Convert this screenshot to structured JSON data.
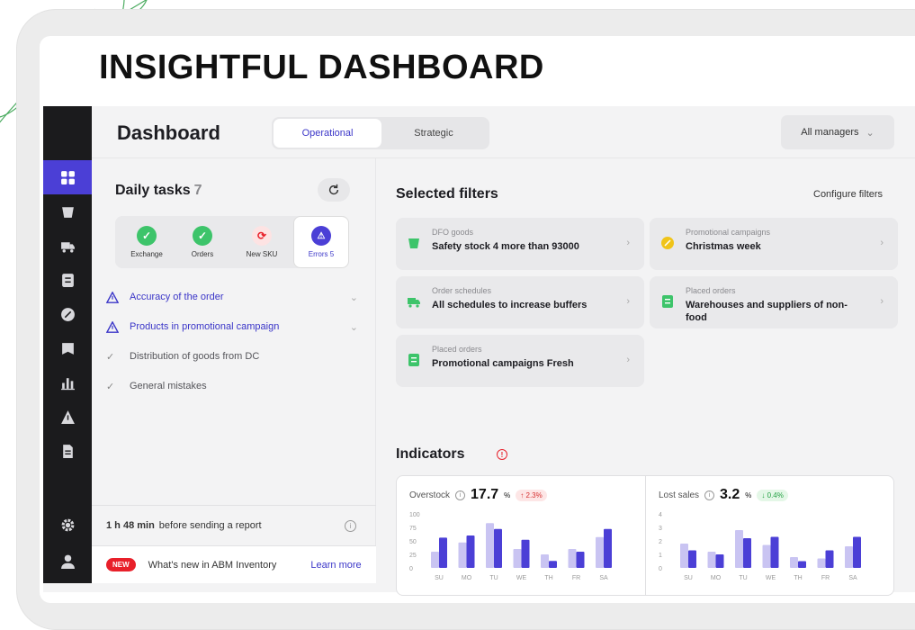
{
  "headline": "INSIGHTFUL DASHBOARD",
  "page_title": "Dashboard",
  "tabs": [
    {
      "label": "Operational",
      "active": true
    },
    {
      "label": "Strategic",
      "active": false
    }
  ],
  "managers_select": {
    "selected": "All managers"
  },
  "sidebar": {
    "items": [
      "grid-icon",
      "bucket-icon",
      "truck-icon",
      "list-icon",
      "percent-icon",
      "book-icon",
      "chart-icon",
      "alert-icon",
      "document-icon"
    ],
    "bottom": [
      "gear-icon",
      "user-icon"
    ]
  },
  "daily_tasks": {
    "title": "Daily tasks",
    "count": "7",
    "cards": [
      {
        "label": "Exchange",
        "status": "ok"
      },
      {
        "label": "Orders",
        "status": "ok"
      },
      {
        "label": "New SKU",
        "status": "sync"
      },
      {
        "label": "Errors 5",
        "status": "error",
        "selected": true
      }
    ],
    "items": [
      {
        "label": "Accuracy of the order",
        "type": "warning",
        "expandable": true
      },
      {
        "label": "Products in promotional campaign",
        "type": "warning",
        "expandable": true
      },
      {
        "label": "Distribution of goods from DC",
        "type": "done"
      },
      {
        "label": "General mistakes",
        "type": "done"
      }
    ]
  },
  "report": {
    "time": "1 h 48 min",
    "text": "before sending a report"
  },
  "news": {
    "badge": "NEW",
    "text": "What's new in ABM Inventory",
    "link": "Learn more"
  },
  "filters": {
    "title": "Selected filters",
    "configure": "Configure filters",
    "cards": [
      {
        "sub": "DFO goods",
        "main": "Safety stock 4 more than 93000",
        "icon": "bucket-icon",
        "color": "#3dc46a"
      },
      {
        "sub": "Promotional campaigns",
        "main": "Christmas week",
        "icon": "percent-icon",
        "color": "#f0c419"
      },
      {
        "sub": "Order schedules",
        "main": "All schedules to increase buffers",
        "icon": "truck-icon",
        "color": "#3dc46a"
      },
      {
        "sub": "Placed orders",
        "main": "Warehouses and suppliers of non-food",
        "icon": "list-icon",
        "color": "#3dc46a"
      },
      {
        "sub": "Placed orders",
        "main": "Promotional campaigns Fresh",
        "icon": "list-icon",
        "color": "#3dc46a"
      }
    ]
  },
  "indicators": {
    "title": "Indicators",
    "alert_icon": "alert-circle-icon"
  },
  "chart_data": [
    {
      "type": "bar",
      "title": "Overstock",
      "value": "17.7",
      "unit": "%",
      "delta": "↑ 2.3%",
      "delta_dir": "up",
      "categories": [
        "SU",
        "MO",
        "TU",
        "WE",
        "TH",
        "FR",
        "SA"
      ],
      "yticks": [
        "100",
        "75",
        "50",
        "25",
        "0"
      ],
      "ylim": [
        0,
        100
      ],
      "series": [
        {
          "values": [
            30,
            47,
            83,
            35,
            25,
            35,
            57
          ],
          "color": "#c9c4f2"
        },
        {
          "values": [
            56,
            60,
            72,
            52,
            13,
            30,
            72
          ],
          "color": "#4b3fd6"
        }
      ]
    },
    {
      "type": "bar",
      "title": "Lost sales",
      "value": "3.2",
      "unit": "%",
      "delta": "↓ 0.4%",
      "delta_dir": "down",
      "categories": [
        "SU",
        "MO",
        "TU",
        "WE",
        "TH",
        "FR",
        "SA"
      ],
      "yticks": [
        "4",
        "3",
        "2",
        "1",
        "0"
      ],
      "ylim": [
        0,
        4
      ],
      "series": [
        {
          "values": [
            1.8,
            1.2,
            2.8,
            1.7,
            0.8,
            0.7,
            1.6
          ],
          "color": "#c9c4f2"
        },
        {
          "values": [
            1.3,
            1.0,
            2.2,
            2.3,
            0.5,
            1.3,
            2.3
          ],
          "color": "#4b3fd6"
        }
      ]
    }
  ]
}
